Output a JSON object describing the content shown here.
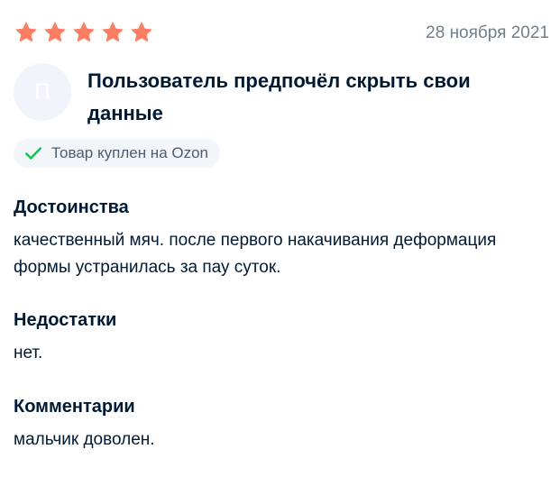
{
  "review": {
    "rating": 5,
    "rating_max": 5,
    "star_color": "#f97e63",
    "date": "28 ноября 2021",
    "author": {
      "avatar_letter": "П",
      "name": "Пользователь предпочёл скрыть свои данные"
    },
    "badge": {
      "icon": "check-icon",
      "icon_color": "#10c44c",
      "label": "Товар куплен на Ozon"
    },
    "sections": [
      {
        "title": "Достоинства",
        "text": "качественный мяч. после первого накачивания деформация формы устранилась за пау суток."
      },
      {
        "title": "Недостатки",
        "text": "нет."
      },
      {
        "title": "Комментарии",
        "text": "мальчик доволен."
      }
    ]
  }
}
